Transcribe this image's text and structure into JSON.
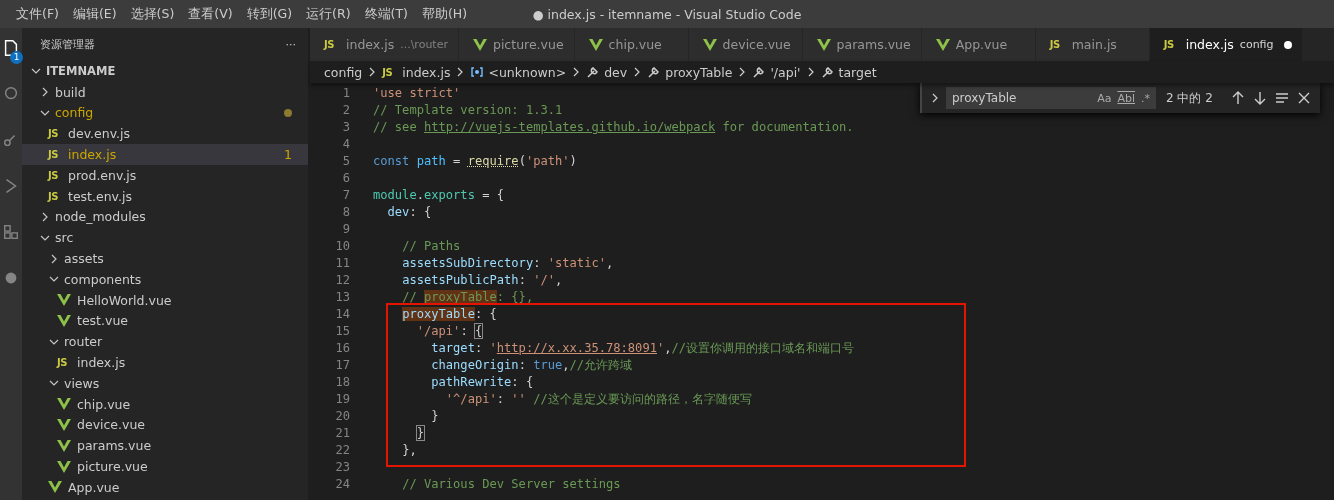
{
  "title_bar": {
    "menus": [
      "文件(F)",
      "编辑(E)",
      "选择(S)",
      "查看(V)",
      "转到(G)",
      "运行(R)",
      "终端(T)",
      "帮助(H)"
    ],
    "title": "● index.js - itemname - Visual Studio Code"
  },
  "activity_bar": {
    "items": [
      {
        "kind": "files",
        "selected": true,
        "badge": "1"
      },
      {
        "kind": "search",
        "selected": false
      },
      {
        "kind": "git",
        "selected": false
      },
      {
        "kind": "run",
        "selected": false
      },
      {
        "kind": "extensions",
        "selected": false
      },
      {
        "kind": "remote",
        "selected": false
      }
    ]
  },
  "sidebar": {
    "title": "资源管理器",
    "more": "···",
    "tree": [
      {
        "label": "ITEMNAME",
        "kind": "root",
        "expanded": true,
        "selected": false,
        "warning": false,
        "children": [
          {
            "label": "build",
            "kind": "folder",
            "expanded": false,
            "selected": false,
            "warning": false
          },
          {
            "label": "config",
            "kind": "folder",
            "expanded": true,
            "selected": false,
            "warning": true,
            "children": [
              {
                "label": "dev.env.js",
                "kind": "js",
                "icon_text": "JS",
                "selected": false,
                "warning": false
              },
              {
                "label": "index.js",
                "kind": "js",
                "icon_text": "JS",
                "selected": true,
                "warning": true,
                "badge": "1"
              },
              {
                "label": "prod.env.js",
                "kind": "js",
                "icon_text": "JS",
                "selected": false,
                "warning": false
              },
              {
                "label": "test.env.js",
                "kind": "js",
                "icon_text": "JS",
                "selected": false,
                "warning": false
              }
            ]
          },
          {
            "label": "node_modules",
            "kind": "folder",
            "expanded": false,
            "selected": false,
            "warning": false
          },
          {
            "label": "src",
            "kind": "folder",
            "expanded": true,
            "selected": false,
            "warning": false,
            "children": [
              {
                "label": "assets",
                "kind": "folder",
                "expanded": false,
                "selected": false,
                "warning": false
              },
              {
                "label": "components",
                "kind": "folder",
                "expanded": true,
                "selected": false,
                "warning": false,
                "children": [
                  {
                    "label": "HelloWorld.vue",
                    "kind": "vue",
                    "selected": false,
                    "warning": false
                  },
                  {
                    "label": "test.vue",
                    "kind": "vue",
                    "selected": false,
                    "warning": false
                  }
                ]
              },
              {
                "label": "router",
                "kind": "folder",
                "expanded": true,
                "selected": false,
                "warning": false,
                "children": [
                  {
                    "label": "index.js",
                    "kind": "js",
                    "icon_text": "JS",
                    "selected": false,
                    "warning": false
                  }
                ]
              },
              {
                "label": "views",
                "kind": "folder",
                "expanded": true,
                "selected": false,
                "warning": false,
                "children": [
                  {
                    "label": "chip.vue",
                    "kind": "vue",
                    "selected": false,
                    "warning": false
                  },
                  {
                    "label": "device.vue",
                    "kind": "vue",
                    "selected": false,
                    "warning": false
                  },
                  {
                    "label": "params.vue",
                    "kind": "vue",
                    "selected": false,
                    "warning": false
                  },
                  {
                    "label": "picture.vue",
                    "kind": "vue",
                    "selected": false,
                    "warning": false
                  }
                ]
              },
              {
                "label": "App.vue",
                "kind": "vue",
                "selected": false,
                "warning": false
              }
            ]
          }
        ]
      }
    ]
  },
  "tabs": [
    {
      "label": "index.js",
      "hint": "...\\router",
      "kind": "js",
      "icon_text": "JS",
      "selected": false,
      "dirty": false
    },
    {
      "label": "picture.vue",
      "kind": "vue",
      "selected": false,
      "dirty": false
    },
    {
      "label": "chip.vue",
      "kind": "vue",
      "selected": false,
      "dirty": false
    },
    {
      "label": "device.vue",
      "kind": "vue",
      "selected": false,
      "dirty": false
    },
    {
      "label": "params.vue",
      "kind": "vue",
      "selected": false,
      "dirty": false
    },
    {
      "label": "App.vue",
      "kind": "vue",
      "selected": false,
      "dirty": false
    },
    {
      "label": "main.js",
      "kind": "js",
      "icon_text": "JS",
      "selected": false,
      "dirty": false
    },
    {
      "label": "index.js",
      "hint": "config",
      "kind": "js",
      "icon_text": "JS",
      "selected": true,
      "dirty": true
    }
  ],
  "breadcrumbs": [
    {
      "label": "config",
      "kind": "folder"
    },
    {
      "label": "index.js",
      "kind": "js",
      "icon_text": "JS"
    },
    {
      "label": "<unknown>",
      "kind": "symbol"
    },
    {
      "label": "dev",
      "kind": "property"
    },
    {
      "label": "proxyTable",
      "kind": "property"
    },
    {
      "label": "'/api'",
      "kind": "property"
    },
    {
      "label": "target",
      "kind": "property"
    }
  ],
  "find_widget": {
    "value": "proxyTable",
    "options": [
      "Aa",
      "Abl",
      ".*"
    ],
    "count": "2 中的 2"
  },
  "code": [
    {
      "number": "1",
      "tokens": [
        {
          "t": "'use strict'",
          "kind": "str"
        }
      ]
    },
    {
      "number": "2",
      "tokens": [
        {
          "t": "// Template version: 1.3.1",
          "kind": "cmt"
        }
      ]
    },
    {
      "number": "3",
      "tokens": [
        {
          "t": "// see ",
          "kind": "cmt"
        },
        {
          "t": "http://vuejs-templates.github.io/webpack",
          "kind": "link"
        },
        {
          "t": " for documentation.",
          "kind": "cmt"
        }
      ]
    },
    {
      "number": "4"
    },
    {
      "number": "5",
      "tokens": [
        {
          "t": "const",
          "kind": "kw"
        },
        {
          "t": " path",
          "kind": "var"
        },
        {
          "t": " = ",
          "kind": "plain"
        },
        {
          "t": "require",
          "kind": "fn"
        },
        {
          "t": "(",
          "kind": "plain"
        },
        {
          "t": "'path'",
          "kind": "str"
        },
        {
          "t": ")",
          "kind": "plain"
        }
      ]
    },
    {
      "number": "6"
    },
    {
      "number": "7",
      "tokens": [
        {
          "t": "module",
          "kind": "obj"
        },
        {
          "t": ".",
          "kind": "plain"
        },
        {
          "t": "exports",
          "kind": "obj"
        },
        {
          "t": " = {",
          "kind": "plain"
        }
      ]
    },
    {
      "number": "8",
      "tokens": [
        {
          "t": "  dev",
          "kind": "prop"
        },
        {
          "t": ": {",
          "kind": "plain"
        }
      ]
    },
    {
      "number": "9"
    },
    {
      "number": "10",
      "tokens": [
        {
          "t": "    // Paths",
          "kind": "cmt"
        }
      ]
    },
    {
      "number": "11",
      "tokens": [
        {
          "t": "    assetsSubDirectory",
          "kind": "prop"
        },
        {
          "t": ": ",
          "kind": "plain"
        },
        {
          "t": "'static'",
          "kind": "str"
        },
        {
          "t": ",",
          "kind": "plain"
        }
      ]
    },
    {
      "number": "12",
      "tokens": [
        {
          "t": "    assetsPublicPath",
          "kind": "prop"
        },
        {
          "t": ": ",
          "kind": "plain"
        },
        {
          "t": "'/'",
          "kind": "str"
        },
        {
          "t": ",",
          "kind": "plain"
        }
      ]
    },
    {
      "number": "13",
      "tokens": [
        {
          "t": "    // ",
          "kind": "cmt"
        },
        {
          "t": "proxyTable",
          "kind": "match-cmt"
        },
        {
          "t": ": {},",
          "kind": "cmt"
        }
      ]
    },
    {
      "number": "14",
      "tokens": [
        {
          "t": "    proxyTable",
          "kind": "match-prop"
        },
        {
          "t": ": {",
          "kind": "plain"
        }
      ]
    },
    {
      "number": "15",
      "tokens": [
        {
          "t": "      '/api'",
          "kind": "str"
        },
        {
          "t": ": ",
          "kind": "plain"
        },
        {
          "t": "{",
          "kind": "bracket"
        }
      ]
    },
    {
      "number": "16",
      "tokens": [
        {
          "t": "        target",
          "kind": "prop"
        },
        {
          "t": ": ",
          "kind": "plain"
        },
        {
          "t": "'",
          "kind": "str"
        },
        {
          "t": "http://x.xx.35.78:8091",
          "kind": "strlink"
        },
        {
          "t": "'",
          "kind": "str"
        },
        {
          "t": ",",
          "kind": "plain"
        },
        {
          "t": "//设置你调用的接口域名和端口号",
          "kind": "cmt"
        }
      ]
    },
    {
      "number": "17",
      "tokens": [
        {
          "t": "        changeOrigin",
          "kind": "prop"
        },
        {
          "t": ": ",
          "kind": "plain"
        },
        {
          "t": "true",
          "kind": "kw"
        },
        {
          "t": ",",
          "kind": "plain"
        },
        {
          "t": "//允许跨域",
          "kind": "cmt"
        }
      ]
    },
    {
      "number": "18",
      "tokens": [
        {
          "t": "        pathRewrite",
          "kind": "prop"
        },
        {
          "t": ": {",
          "kind": "plain"
        }
      ]
    },
    {
      "number": "19",
      "tokens": [
        {
          "t": "          '^/api'",
          "kind": "str"
        },
        {
          "t": ": ",
          "kind": "plain"
        },
        {
          "t": "''",
          "kind": "str"
        },
        {
          "t": " //这个是定义要访问的路径，名字随便写",
          "kind": "cmt"
        }
      ]
    },
    {
      "number": "20",
      "tokens": [
        {
          "t": "        }",
          "kind": "plain"
        }
      ]
    },
    {
      "number": "21",
      "tokens": [
        {
          "t": "      }",
          "kind": "bracket"
        }
      ]
    },
    {
      "number": "22",
      "tokens": [
        {
          "t": "    },",
          "kind": "plain"
        }
      ]
    },
    {
      "number": "23"
    },
    {
      "number": "24",
      "tokens": [
        {
          "t": "    // Various Dev Server settings",
          "kind": "cmt"
        }
      ]
    }
  ]
}
